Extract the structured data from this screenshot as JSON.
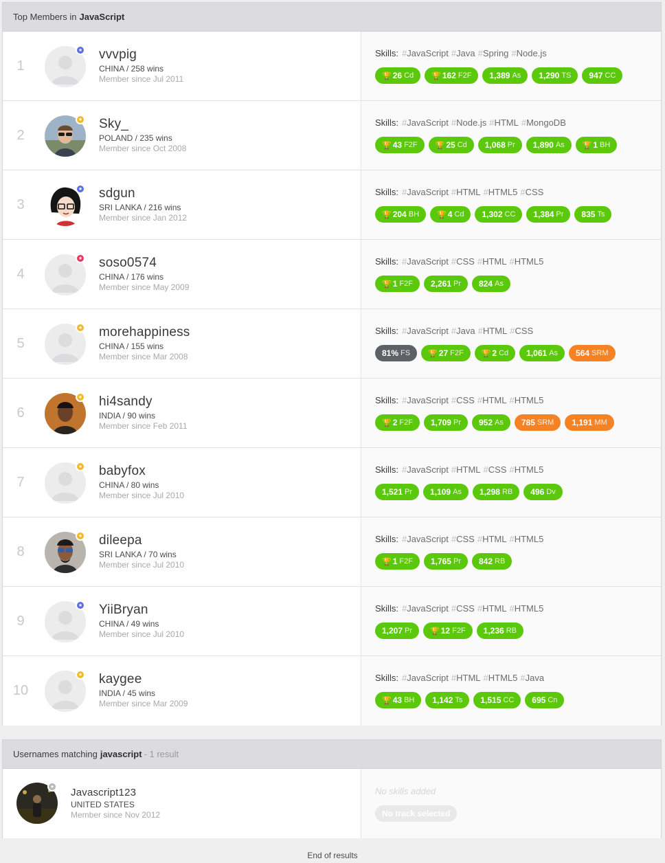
{
  "top_members": {
    "header_prefix": "Top Members in ",
    "header_track": "JavaScript",
    "skills_label": "Skills:",
    "rows": [
      {
        "rank": "1",
        "handle": "vvvpig",
        "country_wins": "CHINA / 258 wins",
        "since": "Member since Jul 2011",
        "badge_color": "#5a6ee6",
        "avatar": "default",
        "skills": [
          "JavaScript",
          "Java",
          "Spring",
          "Node.js"
        ],
        "pills": [
          {
            "value": "26",
            "label": "Cd",
            "trophy": true,
            "color": "green"
          },
          {
            "value": "162",
            "label": "F2F",
            "trophy": true,
            "color": "green"
          },
          {
            "value": "1,389",
            "label": "As",
            "trophy": false,
            "color": "green"
          },
          {
            "value": "1,290",
            "label": "TS",
            "trophy": false,
            "color": "green"
          },
          {
            "value": "947",
            "label": "CC",
            "trophy": false,
            "color": "green"
          }
        ]
      },
      {
        "rank": "2",
        "handle": "Sky_",
        "country_wins": "POLAND / 235 wins",
        "since": "Member since Oct 2008",
        "badge_color": "#f5b72a",
        "avatar": "photo-man-sunglasses",
        "skills": [
          "JavaScript",
          "Node.js",
          "HTML",
          "MongoDB"
        ],
        "pills": [
          {
            "value": "43",
            "label": "F2F",
            "trophy": true,
            "color": "green"
          },
          {
            "value": "25",
            "label": "Cd",
            "trophy": true,
            "color": "green"
          },
          {
            "value": "1,068",
            "label": "Pr",
            "trophy": false,
            "color": "green"
          },
          {
            "value": "1,890",
            "label": "As",
            "trophy": false,
            "color": "green"
          },
          {
            "value": "1",
            "label": "BH",
            "trophy": true,
            "color": "green"
          }
        ]
      },
      {
        "rank": "3",
        "handle": "sdgun",
        "country_wins": "SRI LANKA / 216 wins",
        "since": "Member since Jan 2012",
        "badge_color": "#5a6ee6",
        "avatar": "cartoon-glasses",
        "skills": [
          "JavaScript",
          "HTML",
          "HTML5",
          "CSS"
        ],
        "pills": [
          {
            "value": "204",
            "label": "BH",
            "trophy": true,
            "color": "green"
          },
          {
            "value": "4",
            "label": "Cd",
            "trophy": true,
            "color": "green"
          },
          {
            "value": "1,302",
            "label": "CC",
            "trophy": false,
            "color": "green"
          },
          {
            "value": "1,384",
            "label": "Pr",
            "trophy": false,
            "color": "green"
          },
          {
            "value": "835",
            "label": "Ts",
            "trophy": false,
            "color": "green"
          }
        ]
      },
      {
        "rank": "4",
        "handle": "soso0574",
        "country_wins": "CHINA / 176 wins",
        "since": "Member since May 2009",
        "badge_color": "#e53a5f",
        "avatar": "default",
        "skills": [
          "JavaScript",
          "CSS",
          "HTML",
          "HTML5"
        ],
        "pills": [
          {
            "value": "1",
            "label": "F2F",
            "trophy": true,
            "color": "green"
          },
          {
            "value": "2,261",
            "label": "Pr",
            "trophy": false,
            "color": "green"
          },
          {
            "value": "824",
            "label": "As",
            "trophy": false,
            "color": "green"
          }
        ]
      },
      {
        "rank": "5",
        "handle": "morehappiness",
        "country_wins": "CHINA / 155 wins",
        "since": "Member since Mar 2008",
        "badge_color": "#f5b72a",
        "avatar": "default",
        "skills": [
          "JavaScript",
          "Java",
          "HTML",
          "CSS"
        ],
        "pills": [
          {
            "value": "81%",
            "label": "FS",
            "trophy": false,
            "color": "gray"
          },
          {
            "value": "27",
            "label": "F2F",
            "trophy": true,
            "color": "green"
          },
          {
            "value": "2",
            "label": "Cd",
            "trophy": true,
            "color": "green"
          },
          {
            "value": "1,061",
            "label": "As",
            "trophy": false,
            "color": "green"
          },
          {
            "value": "564",
            "label": "SRM",
            "trophy": false,
            "color": "orange"
          }
        ]
      },
      {
        "rank": "6",
        "handle": "hi4sandy",
        "country_wins": "INDIA / 90 wins",
        "since": "Member since Feb 2011",
        "badge_color": "#f5b72a",
        "avatar": "photo-man-dark",
        "skills": [
          "JavaScript",
          "CSS",
          "HTML",
          "HTML5"
        ],
        "pills": [
          {
            "value": "2",
            "label": "F2F",
            "trophy": true,
            "color": "green"
          },
          {
            "value": "1,709",
            "label": "Pr",
            "trophy": false,
            "color": "green"
          },
          {
            "value": "952",
            "label": "As",
            "trophy": false,
            "color": "green"
          },
          {
            "value": "785",
            "label": "SRM",
            "trophy": false,
            "color": "orange"
          },
          {
            "value": "1,191",
            "label": "MM",
            "trophy": false,
            "color": "orange"
          }
        ]
      },
      {
        "rank": "7",
        "handle": "babyfox",
        "country_wins": "CHINA / 80 wins",
        "since": "Member since Jul 2010",
        "badge_color": "#f5b72a",
        "avatar": "default",
        "skills": [
          "JavaScript",
          "HTML",
          "CSS",
          "HTML5"
        ],
        "pills": [
          {
            "value": "1,521",
            "label": "Pr",
            "trophy": false,
            "color": "green"
          },
          {
            "value": "1,109",
            "label": "As",
            "trophy": false,
            "color": "green"
          },
          {
            "value": "1,298",
            "label": "RB",
            "trophy": false,
            "color": "green"
          },
          {
            "value": "496",
            "label": "Dv",
            "trophy": false,
            "color": "green"
          }
        ]
      },
      {
        "rank": "8",
        "handle": "dileepa",
        "country_wins": "SRI LANKA / 70 wins",
        "since": "Member since Jul 2010",
        "badge_color": "#f5b72a",
        "avatar": "photo-man-shades",
        "skills": [
          "JavaScript",
          "CSS",
          "HTML",
          "HTML5"
        ],
        "pills": [
          {
            "value": "1",
            "label": "F2F",
            "trophy": true,
            "color": "green"
          },
          {
            "value": "1,765",
            "label": "Pr",
            "trophy": false,
            "color": "green"
          },
          {
            "value": "842",
            "label": "RB",
            "trophy": false,
            "color": "green"
          }
        ]
      },
      {
        "rank": "9",
        "handle": "YiiBryan",
        "country_wins": "CHINA / 49 wins",
        "since": "Member since Jul 2010",
        "badge_color": "#5a6ee6",
        "avatar": "default",
        "skills": [
          "JavaScript",
          "CSS",
          "HTML",
          "HTML5"
        ],
        "pills": [
          {
            "value": "1,207",
            "label": "Pr",
            "trophy": false,
            "color": "green"
          },
          {
            "value": "12",
            "label": "F2F",
            "trophy": true,
            "color": "green"
          },
          {
            "value": "1,236",
            "label": "RB",
            "trophy": false,
            "color": "green"
          }
        ]
      },
      {
        "rank": "10",
        "handle": "kaygee",
        "country_wins": "INDIA / 45 wins",
        "since": "Member since Mar 2009",
        "badge_color": "#f5b72a",
        "avatar": "default",
        "skills": [
          "JavaScript",
          "HTML",
          "HTML5",
          "Java"
        ],
        "pills": [
          {
            "value": "43",
            "label": "BH",
            "trophy": true,
            "color": "green"
          },
          {
            "value": "1,142",
            "label": "Ts",
            "trophy": false,
            "color": "green"
          },
          {
            "value": "1,515",
            "label": "CC",
            "trophy": false,
            "color": "green"
          },
          {
            "value": "695",
            "label": "Cn",
            "trophy": false,
            "color": "green"
          }
        ]
      }
    ]
  },
  "usernames": {
    "header_prefix": "Usernames matching ",
    "header_query": "javascript",
    "header_count": " - 1 result",
    "row": {
      "handle": "Javascript123",
      "country": "UNITED STATES",
      "since": "Member since Nov 2012",
      "badge_color": "#b5b5b8",
      "no_skills": "No skills added",
      "no_track": "No track selected"
    }
  },
  "footer": "End of results",
  "colors": {
    "green": "#5bc80c",
    "orange": "#f58325",
    "gray": "#5e6166"
  }
}
